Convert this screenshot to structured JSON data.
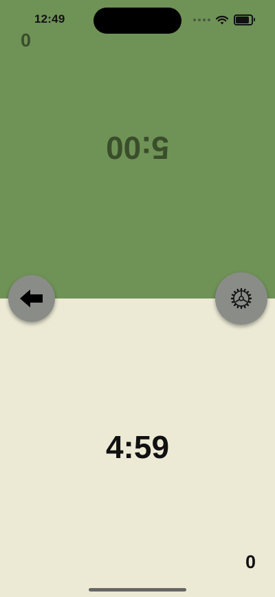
{
  "status_bar": {
    "time": "12:49"
  },
  "player_top": {
    "count": "0",
    "timer": "5:00"
  },
  "player_bottom": {
    "timer": "4:59",
    "count": "0"
  },
  "buttons": {
    "back_icon": "arrow-left-icon",
    "settings_icon": "gear-icon"
  },
  "colors": {
    "top_panel": "#6F9257",
    "bottom_panel": "#ECEAD5",
    "button_bg": "#8A8C88"
  }
}
